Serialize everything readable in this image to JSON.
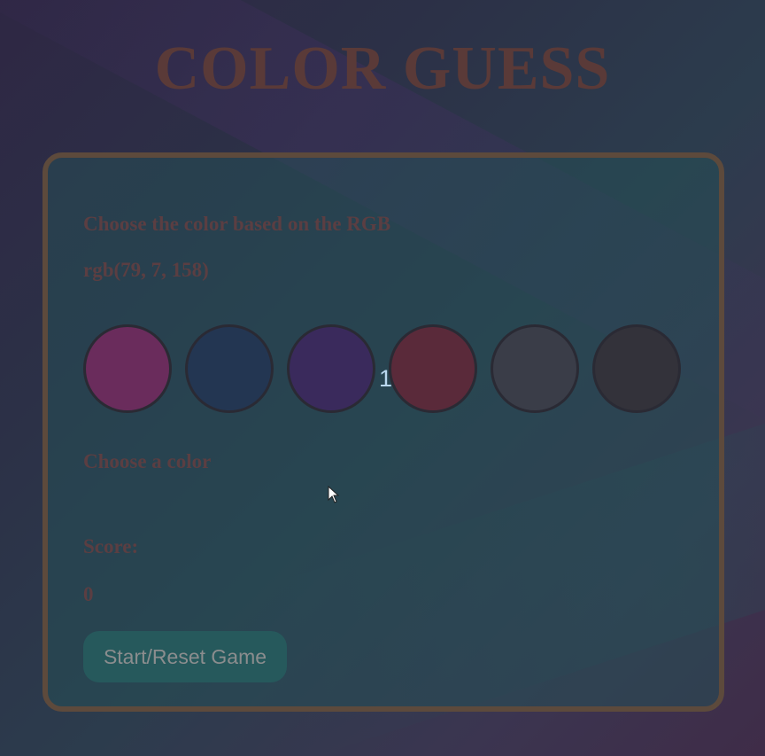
{
  "header": {
    "title": "COLOR GUESS"
  },
  "game": {
    "instruction": "Choose the color based on the RGB",
    "target_rgb": "rgb(79, 7, 158)",
    "color_options": [
      {
        "index": 0,
        "color": "#6a2c5c"
      },
      {
        "index": 1,
        "color": "#233652"
      },
      {
        "index": 2,
        "color": "#3a2a5c"
      },
      {
        "index": 3,
        "color": "#5a2a3a"
      },
      {
        "index": 4,
        "color": "#3a3d48"
      },
      {
        "index": 5,
        "color": "#33323a"
      }
    ],
    "overlay_number": "1",
    "message": "Choose a color",
    "score_label": "Score:",
    "score_value": "0",
    "start_button_label": "Start/Reset Game"
  },
  "colors": {
    "title_text": "#5a3a38",
    "panel_border": "#5d4a3c",
    "panel_background": "#264e56",
    "body_text": "#5b3e42",
    "button_background": "#26595c",
    "button_text": "#8b8d8e"
  },
  "icons": {
    "cursor": "mouse-pointer-icon"
  }
}
